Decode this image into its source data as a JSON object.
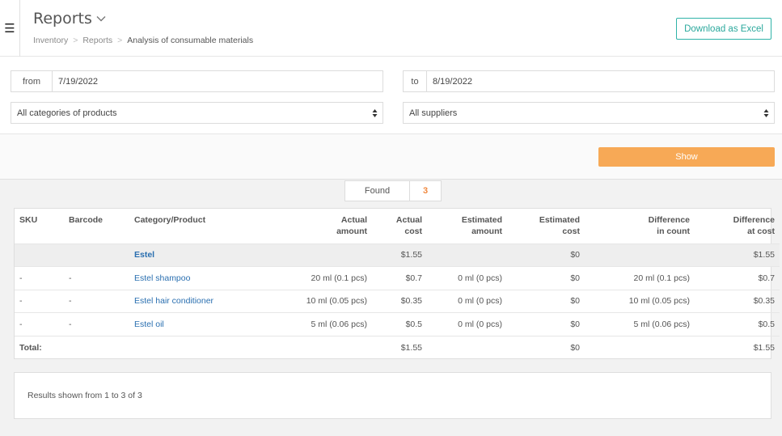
{
  "header": {
    "title": "Reports",
    "breadcrumbs": [
      "Inventory",
      "Reports",
      "Analysis of consumable materials"
    ],
    "download_label": "Download as Excel"
  },
  "filters": {
    "from_label": "from",
    "from_value": "7/19/2022",
    "to_label": "to",
    "to_value": "8/19/2022",
    "category_select": "All categories of products",
    "supplier_select": "All suppliers",
    "show_label": "Show"
  },
  "found": {
    "label": "Found",
    "count": "3"
  },
  "table": {
    "headers": {
      "sku": "SKU",
      "barcode": "Barcode",
      "category": "Category/Product",
      "actual_amount": [
        "Actual",
        "amount"
      ],
      "actual_cost": [
        "Actual",
        "cost"
      ],
      "estimated_amount": [
        "Estimated",
        "amount"
      ],
      "estimated_cost": [
        "Estimated",
        "cost"
      ],
      "diff_count": [
        "Difference",
        "in count"
      ],
      "diff_cost": [
        "Difference",
        "at cost"
      ]
    },
    "group": {
      "name": "Estel",
      "actual_cost": "$1.55",
      "estimated_cost": "$0",
      "diff_cost": "$1.55"
    },
    "rows": [
      {
        "sku": "-",
        "barcode": "-",
        "product": "Estel shampoo",
        "actual_amount": "20 ml (0.1 pcs)",
        "actual_cost": "$0.7",
        "estimated_amount": "0 ml (0 pcs)",
        "estimated_cost": "$0",
        "diff_count": "20 ml (0.1 pcs)",
        "diff_cost": "$0.7"
      },
      {
        "sku": "-",
        "barcode": "-",
        "product": "Estel hair conditioner",
        "actual_amount": "10 ml (0.05 pcs)",
        "actual_cost": "$0.35",
        "estimated_amount": "0 ml (0 pcs)",
        "estimated_cost": "$0",
        "diff_count": "10 ml (0.05 pcs)",
        "diff_cost": "$0.35"
      },
      {
        "sku": "-",
        "barcode": "-",
        "product": "Estel oil",
        "actual_amount": "5 ml (0.06 pcs)",
        "actual_cost": "$0.5",
        "estimated_amount": "0 ml (0 pcs)",
        "estimated_cost": "$0",
        "diff_count": "5 ml (0.06 pcs)",
        "diff_cost": "$0.5"
      }
    ],
    "total": {
      "label": "Total:",
      "actual_cost": "$1.55",
      "estimated_cost": "$0",
      "diff_cost": "$1.55"
    }
  },
  "results_text": "Results shown from 1 to 3 of 3",
  "colors": {
    "accent_teal": "#2fb3a8",
    "show_orange": "#f7a956",
    "link_blue": "#2a6fb0",
    "count_orange": "#f0883e"
  },
  "icons": {
    "menu": "hamburger-icon",
    "title_chevron": "chevron-down-icon",
    "select_arrows": "sort-arrows-icon"
  }
}
